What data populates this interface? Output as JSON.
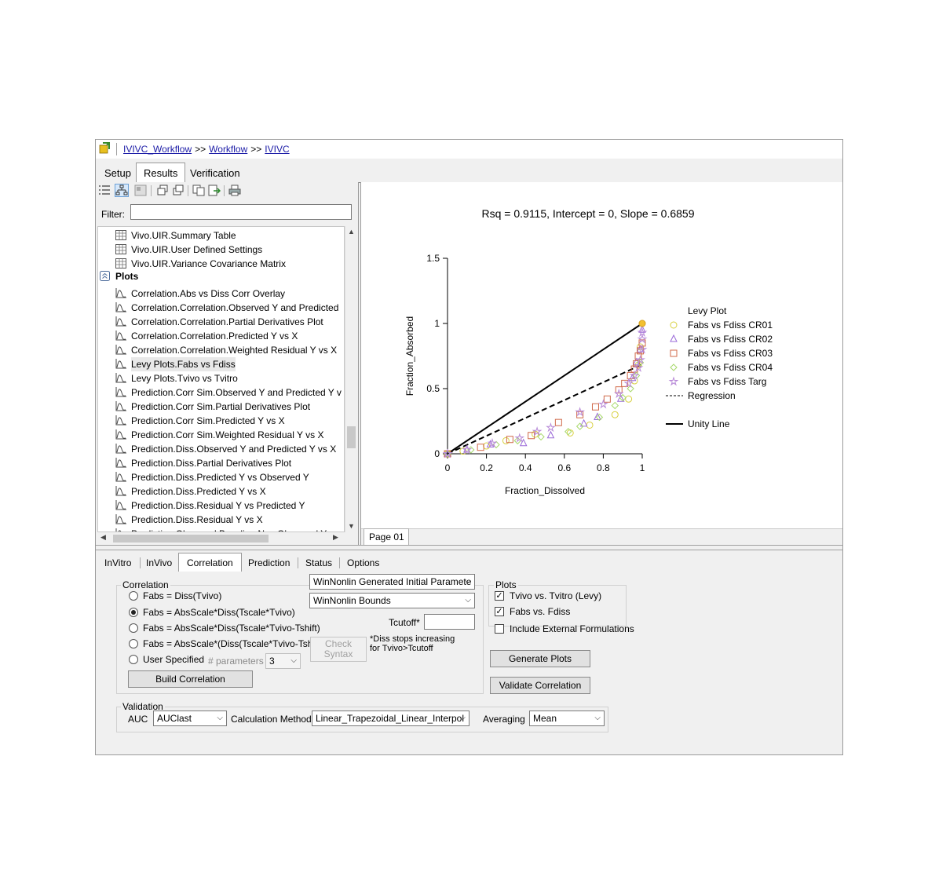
{
  "breadcrumb": {
    "items": [
      "IVIVC_Workflow",
      "Workflow",
      "IVIVC"
    ],
    "separator": ">>"
  },
  "top_tabs": [
    {
      "label": "Setup"
    },
    {
      "label": "Results"
    },
    {
      "label": "Verification"
    }
  ],
  "filter": {
    "label": "Filter:",
    "value": ""
  },
  "tree": {
    "tables": [
      "Vivo.UIR.Summary Table",
      "Vivo.UIR.User Defined Settings",
      "Vivo.UIR.Variance Covariance Matrix"
    ],
    "plots_group": "Plots",
    "plots": [
      "Correlation.Abs vs Diss Corr Overlay",
      "Correlation.Correlation.Observed Y and Predicted",
      "Correlation.Correlation.Partial Derivatives Plot",
      "Correlation.Correlation.Predicted Y vs X",
      "Correlation.Correlation.Weighted Residual Y vs X",
      "Levy Plots.Fabs vs Fdiss",
      "Levy Plots.Tvivo vs Tvitro",
      "Prediction.Corr Sim.Observed Y and Predicted Y v",
      "Prediction.Corr Sim.Partial Derivatives Plot",
      "Prediction.Corr Sim.Predicted Y vs X",
      "Prediction.Corr Sim.Weighted Residual Y vs X",
      "Prediction.Diss.Observed Y and Predicted Y vs X",
      "Prediction.Diss.Partial Derivatives Plot",
      "Prediction.Diss.Predicted Y vs Observed Y",
      "Prediction.Diss.Predicted Y vs X",
      "Prediction.Diss.Residual Y vs Predicted Y",
      "Prediction.Diss.Residual Y vs X",
      "Prediction.Observed Baseline Nca Observed Y an"
    ],
    "selected": "Levy Plots.Fabs vs Fdiss"
  },
  "page_tab": "Page 01",
  "chart_data": {
    "type": "scatter",
    "title": "Rsq = 0.9115, Intercept = 0, Slope = 0.6859",
    "xlabel": "Fraction_Dissolved",
    "ylabel": "Fraction_Absorbed",
    "xlim": [
      0,
      1
    ],
    "ylim": [
      0,
      1.5
    ],
    "xticks": [
      "0",
      "0.2",
      "0.4",
      "0.6",
      "0.8",
      "1"
    ],
    "yticks": [
      "0",
      "0.5",
      "1",
      "1.5"
    ],
    "legend_title": "Levy Plot",
    "legend_placement": "right",
    "series": [
      {
        "name": "Fabs vs Fdiss CR01",
        "marker": "circle",
        "color": "#d8d040",
        "x": [
          0,
          0.08,
          0.2,
          0.3,
          0.45,
          0.63,
          0.73,
          0.86,
          0.93,
          0.96,
          0.98,
          0.99,
          1.0
        ],
        "y": [
          0,
          0.02,
          0.06,
          0.1,
          0.15,
          0.16,
          0.22,
          0.3,
          0.42,
          0.56,
          0.68,
          0.82,
          1.0
        ]
      },
      {
        "name": "Fabs vs Fdiss CR02",
        "marker": "triangle",
        "color": "#9a6ad8",
        "x": [
          0,
          0.1,
          0.22,
          0.39,
          0.53,
          0.7,
          0.77,
          0.89,
          0.95,
          0.97,
          0.99,
          1.0
        ],
        "y": [
          0,
          0.03,
          0.07,
          0.08,
          0.14,
          0.23,
          0.28,
          0.42,
          0.58,
          0.7,
          0.8,
          0.95
        ]
      },
      {
        "name": "Fabs vs Fdiss CR03",
        "marker": "square",
        "color": "#d06a4a",
        "x": [
          0,
          0.17,
          0.32,
          0.43,
          0.57,
          0.68,
          0.76,
          0.82,
          0.88,
          0.91,
          0.94,
          0.96,
          0.97,
          0.98,
          0.99,
          1.0
        ],
        "y": [
          0,
          0.05,
          0.11,
          0.14,
          0.24,
          0.3,
          0.36,
          0.42,
          0.49,
          0.54,
          0.6,
          0.65,
          0.69,
          0.75,
          0.79,
          0.85
        ]
      },
      {
        "name": "Fabs vs Fdiss CR04",
        "marker": "diamond",
        "color": "#a6d86a",
        "x": [
          0,
          0.12,
          0.25,
          0.36,
          0.48,
          0.62,
          0.68,
          0.78,
          0.86,
          0.9,
          0.94,
          0.97,
          0.99
        ],
        "y": [
          0,
          0.03,
          0.07,
          0.1,
          0.13,
          0.17,
          0.21,
          0.28,
          0.37,
          0.43,
          0.5,
          0.6,
          0.7
        ]
      },
      {
        "name": "Fabs vs Fdiss Targ",
        "marker": "star",
        "color": "#b88ad8",
        "x": [
          0,
          0.1,
          0.23,
          0.37,
          0.46,
          0.53,
          0.68,
          0.8,
          0.88,
          0.93,
          0.96,
          0.98,
          0.99,
          1.0,
          1.0,
          1.0
        ],
        "y": [
          0,
          0.03,
          0.08,
          0.12,
          0.17,
          0.2,
          0.32,
          0.38,
          0.46,
          0.54,
          0.6,
          0.66,
          0.72,
          0.8,
          0.88,
          0.93
        ]
      },
      {
        "name": "Regression",
        "type": "line",
        "style": "dashed",
        "color": "#000000",
        "x": [
          0,
          1
        ],
        "y": [
          0,
          0.6859
        ]
      },
      {
        "name": "Unity Line",
        "type": "line",
        "style": "solid",
        "color": "#000000",
        "x": [
          0,
          1
        ],
        "y": [
          0,
          1
        ]
      }
    ]
  },
  "bottom_tabs": [
    {
      "label": "InVitro"
    },
    {
      "label": "InVivo"
    },
    {
      "label": "Correlation"
    },
    {
      "label": "Prediction"
    },
    {
      "label": "Status"
    },
    {
      "label": "Options"
    }
  ],
  "correlation": {
    "title": "Correlation",
    "options": [
      "Fabs = Diss(Tvivo)",
      "Fabs = AbsScale*Diss(Tscale*Tvivo)",
      "Fabs = AbsScale*Diss(Tscale*Tvivo-Tshift)",
      "Fabs = AbsScale*(Diss(Tscale*Tvivo-Tshift)-AbsBase)",
      "User Specified"
    ],
    "selected_index": 1,
    "initial_params": "WinNonlin Generated Initial Paramete",
    "bounds": "WinNonlin Bounds",
    "tcutoff_label": "Tcutoff*",
    "tcutoff_value": "",
    "nparams_label": "# parameters",
    "nparams_value": "3",
    "check_syntax_line1": "Check",
    "check_syntax_line2": "Syntax",
    "note_line1": "*Diss stops increasing",
    "note_line2": "for Tvivo>Tcutoff",
    "build_label": "Build Correlation"
  },
  "plots_panel": {
    "title": "Plots",
    "options": [
      {
        "label": "Tvivo vs. Tvitro (Levy)",
        "checked": true
      },
      {
        "label": "Fabs vs. Fdiss",
        "checked": true
      },
      {
        "label": "Include External Formulations",
        "checked": false
      }
    ],
    "generate_label": "Generate Plots",
    "validate_label": "Validate Correlation"
  },
  "validation": {
    "title": "Validation",
    "auc_label": "AUC",
    "auc_value": "AUClast",
    "calc_label": "Calculation Method",
    "calc_value": "Linear_Trapezoidal_Linear_Interpol",
    "avg_label": "Averaging",
    "avg_value": "Mean"
  }
}
